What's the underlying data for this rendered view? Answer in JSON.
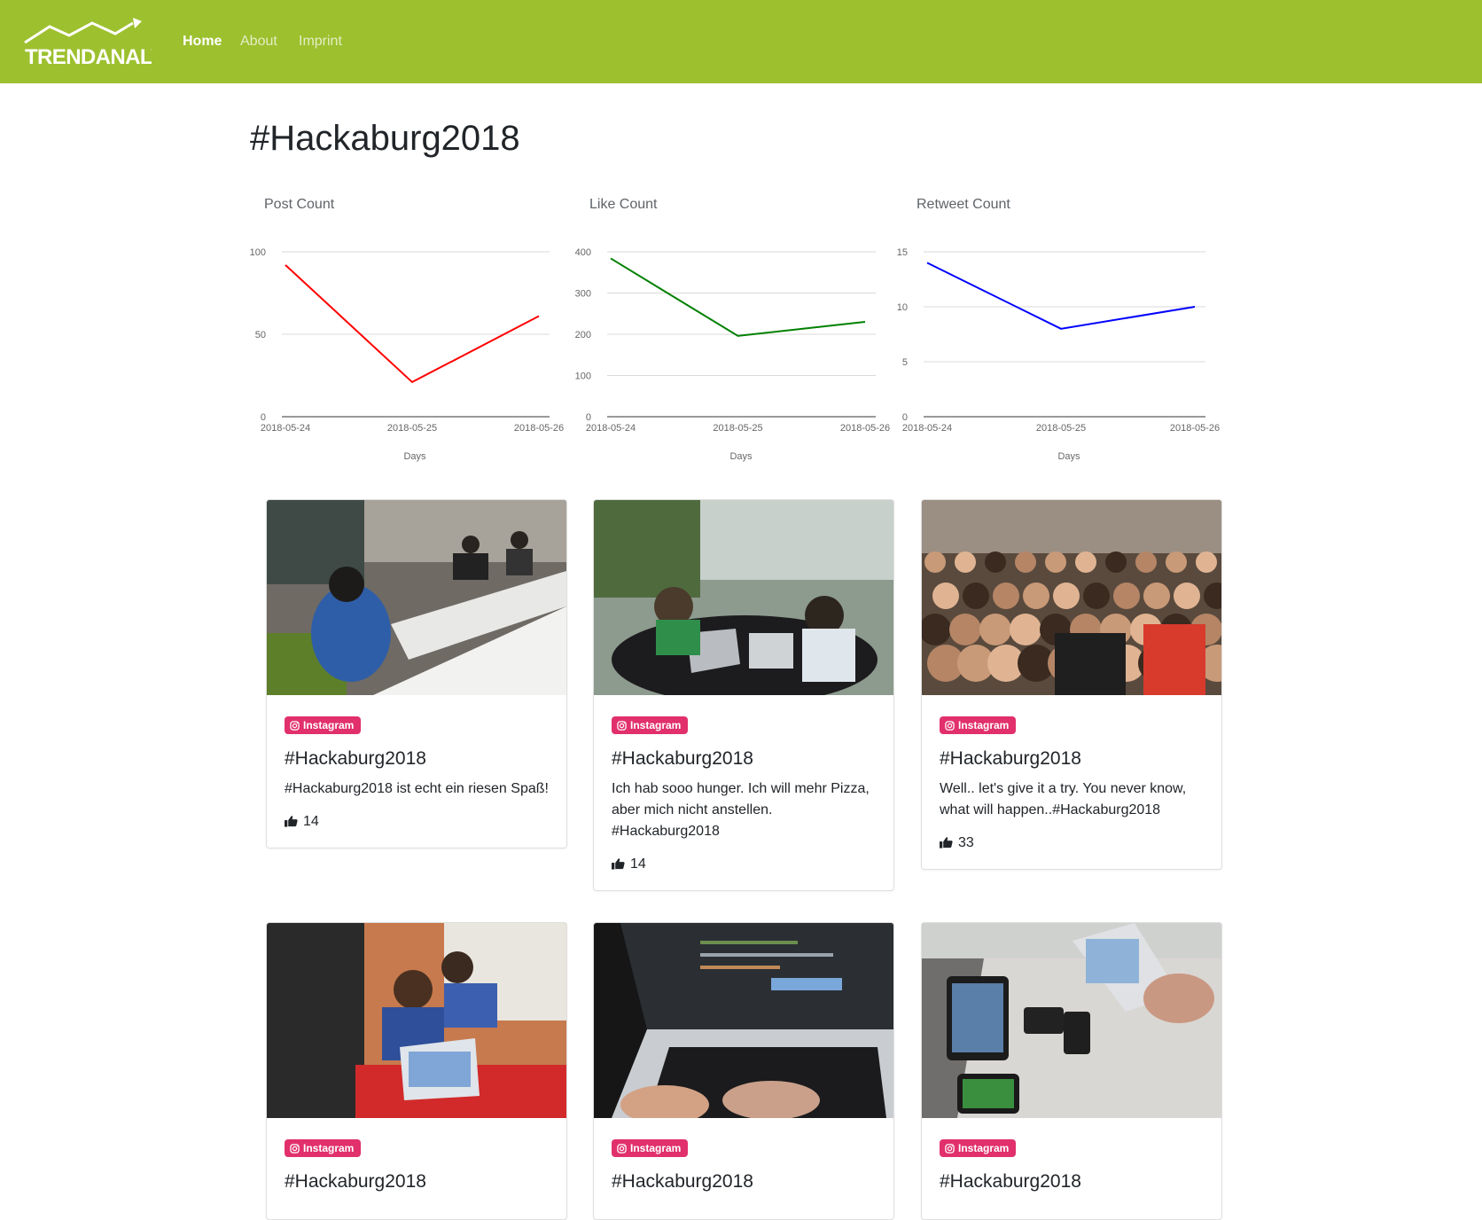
{
  "navbar": {
    "brand": "TRENDANALYZER",
    "links": [
      {
        "label": "Home",
        "active": true
      },
      {
        "label": "About",
        "active": false
      },
      {
        "label": "Imprint",
        "active": false
      }
    ],
    "color": "#9dc02e"
  },
  "page": {
    "title": "#Hackaburg2018"
  },
  "chart_data": [
    {
      "type": "line",
      "title": "Post Count",
      "xlabel": "Days",
      "categories": [
        "2018-05-24",
        "2018-05-25",
        "2018-05-26"
      ],
      "series": [
        {
          "values": [
            92,
            21,
            61
          ],
          "color": "#ff0000"
        }
      ],
      "yticks": [
        0,
        50,
        100
      ],
      "ylim": [
        0,
        100
      ],
      "grid": true
    },
    {
      "type": "line",
      "title": "Like Count",
      "xlabel": "Days",
      "categories": [
        "2018-05-24",
        "2018-05-25",
        "2018-05-26"
      ],
      "series": [
        {
          "values": [
            384,
            196,
            230
          ],
          "color": "#008000"
        }
      ],
      "yticks": [
        0,
        100,
        200,
        300,
        400
      ],
      "ylim": [
        0,
        400
      ],
      "grid": true
    },
    {
      "type": "line",
      "title": "Retweet Count",
      "xlabel": "Days",
      "categories": [
        "2018-05-24",
        "2018-05-25",
        "2018-05-26"
      ],
      "series": [
        {
          "values": [
            14,
            8,
            10
          ],
          "color": "#0000ff"
        }
      ],
      "yticks": [
        0,
        5,
        10,
        15
      ],
      "ylim": [
        0,
        15
      ],
      "grid": true
    }
  ],
  "posts": [
    {
      "source": "Instagram",
      "title": "#Hackaburg2018",
      "text": "#Hackaburg2018 ist echt ein riesen Spaß!",
      "likes": "14",
      "photo": "hackathon-tables"
    },
    {
      "source": "Instagram",
      "title": "#Hackaburg2018",
      "text": "Ich hab sooo hunger. Ich will mehr Pizza, aber mich nicht anstellen. #Hackaburg2018",
      "likes": "14",
      "photo": "atrium-laptops"
    },
    {
      "source": "Instagram",
      "title": "#Hackaburg2018",
      "text": "Well.. let's give it a try. You never know, what will happen..#Hackaburg2018",
      "likes": "33",
      "photo": "audience"
    },
    {
      "source": "Instagram",
      "title": "#Hackaburg2018",
      "text": "",
      "likes": "",
      "photo": "headphones-coder"
    },
    {
      "source": "Instagram",
      "title": "#Hackaburg2018",
      "text": "",
      "likes": "",
      "photo": "macbook-typing"
    },
    {
      "source": "Instagram",
      "title": "#Hackaburg2018",
      "text": "",
      "likes": "",
      "photo": "ipads-phones"
    }
  ],
  "icons": {
    "badge": "instagram-icon",
    "likes": "thumbs-up-icon"
  },
  "colors": {
    "badge": "#e1306c"
  }
}
